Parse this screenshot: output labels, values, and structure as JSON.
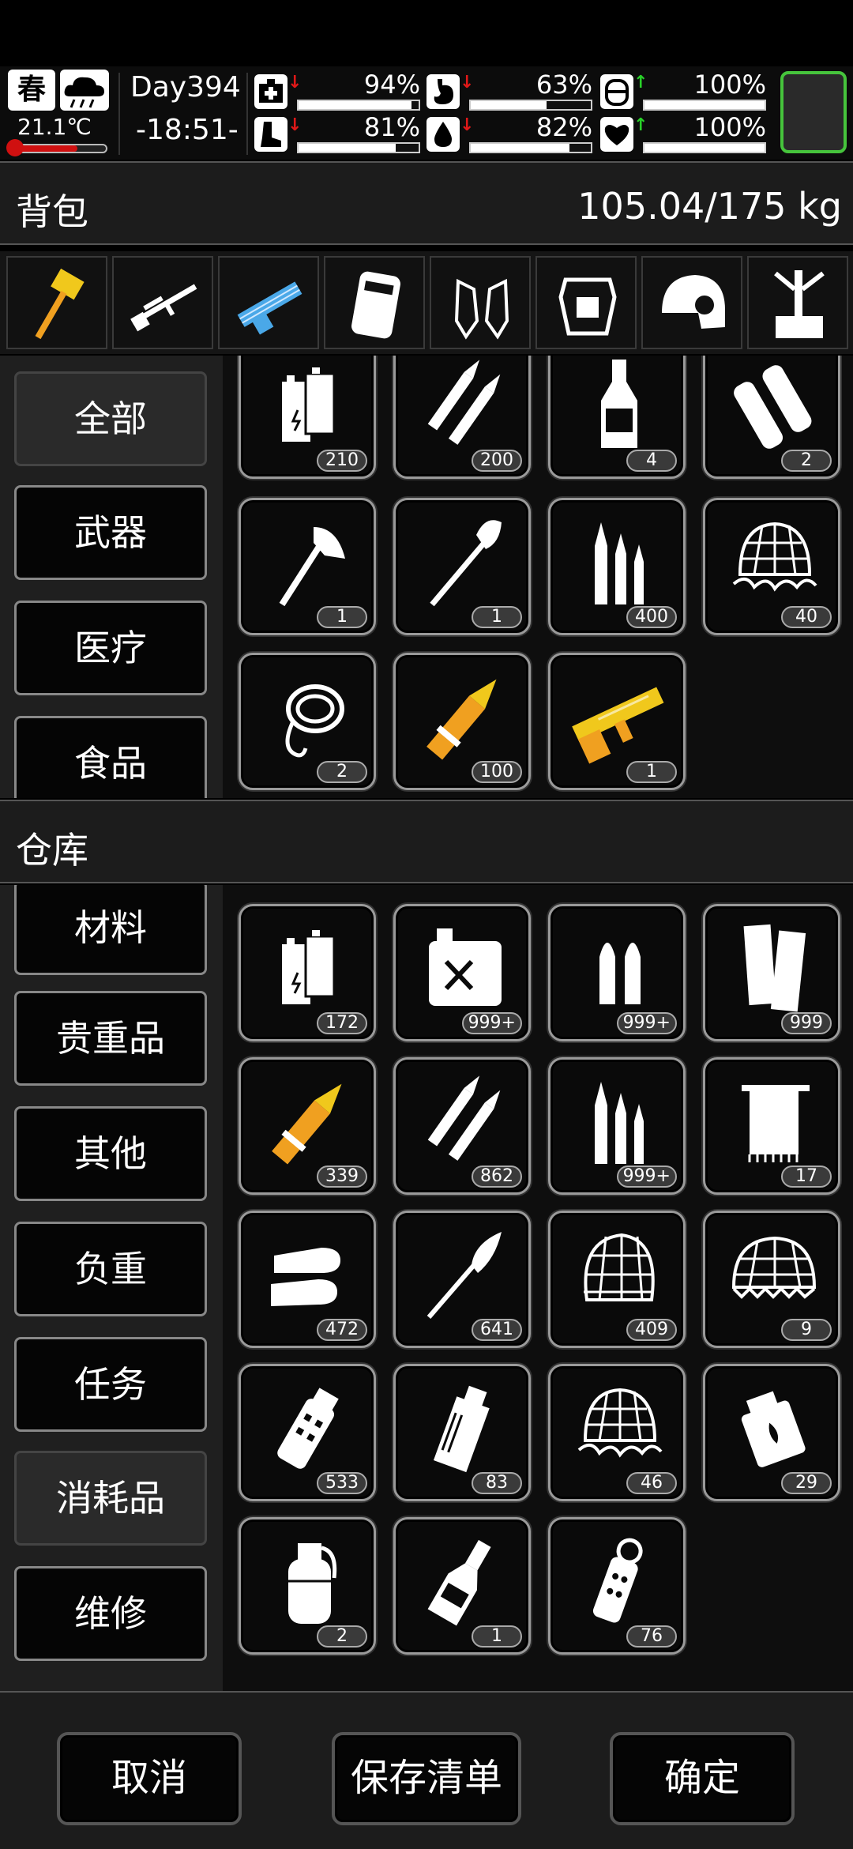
{
  "hud": {
    "season": "春",
    "temperature": "21.1℃",
    "day": "Day394",
    "time": "-18:51-",
    "stats": [
      {
        "name": "health",
        "value": "94%",
        "level": 0.94,
        "arrow": "down",
        "arrow_color": "#e01818"
      },
      {
        "name": "hunger",
        "value": "63%",
        "level": 0.63,
        "arrow": "down",
        "arrow_color": "#e01818"
      },
      {
        "name": "armor",
        "value": "100%",
        "level": 1.0,
        "arrow": "up",
        "arrow_color": "#28d028"
      },
      {
        "name": "stamina",
        "value": "81%",
        "level": 0.81,
        "arrow": "down",
        "arrow_color": "#e01818"
      },
      {
        "name": "thirst",
        "value": "82%",
        "level": 0.82,
        "arrow": "down",
        "arrow_color": "#e01818"
      },
      {
        "name": "mood",
        "value": "100%",
        "level": 1.0,
        "arrow": "up",
        "arrow_color": "#28d028"
      }
    ]
  },
  "backpack": {
    "title": "背包",
    "weight": "105.04/175 kg",
    "equipment": [
      "hammer-icon",
      "sniper-rifle-icon",
      "minigun-icon",
      "vest-icon",
      "gloves-icon",
      "body-armor-icon",
      "helmet-icon",
      "backpack-frame-icon"
    ],
    "categories": [
      "全部",
      "武器",
      "医疗",
      "食品"
    ],
    "items": [
      {
        "icon": "battery-icon",
        "count": "210"
      },
      {
        "icon": "bullets-icon",
        "count": "200"
      },
      {
        "icon": "bottle-icon",
        "count": "4"
      },
      {
        "icon": "cloth-roll-icon",
        "count": "2"
      },
      {
        "icon": "axe-icon",
        "count": "1"
      },
      {
        "icon": "shovel-icon",
        "count": "1"
      },
      {
        "icon": "rifle-ammo-icon",
        "count": "400"
      },
      {
        "icon": "ghillie-net-icon",
        "count": "40"
      },
      {
        "icon": "rope-icon",
        "count": "2"
      },
      {
        "icon": "rocket-icon",
        "count": "100"
      },
      {
        "icon": "shotgun-icon",
        "count": "1"
      }
    ]
  },
  "warehouse": {
    "title": "仓库",
    "categories": [
      "材料",
      "贵重品",
      "其他",
      "负重",
      "任务",
      "消耗品",
      "维修"
    ],
    "active_category": "消耗品",
    "items": [
      {
        "icon": "battery-icon",
        "count": "172"
      },
      {
        "icon": "fuel-can-icon",
        "count": "999+"
      },
      {
        "icon": "pistol-ammo-icon",
        "count": "999+"
      },
      {
        "icon": "shotgun-shells-icon",
        "count": "999"
      },
      {
        "icon": "rocket-icon",
        "count": "339"
      },
      {
        "icon": "bullets-icon",
        "count": "862"
      },
      {
        "icon": "rifle-ammo-icon",
        "count": "999+"
      },
      {
        "icon": "towel-icon",
        "count": "17"
      },
      {
        "icon": "slug-icon",
        "count": "472"
      },
      {
        "icon": "rpg-icon",
        "count": "641"
      },
      {
        "icon": "net-icon",
        "count": "409"
      },
      {
        "icon": "helmet-net-icon",
        "count": "9"
      },
      {
        "icon": "flashbang-icon",
        "count": "533"
      },
      {
        "icon": "smoke-grenade-icon",
        "count": "83"
      },
      {
        "icon": "ghillie-net-icon",
        "count": "46"
      },
      {
        "icon": "incendiary-icon",
        "count": "29"
      },
      {
        "icon": "frag-grenade-icon",
        "count": "2"
      },
      {
        "icon": "molotov-icon",
        "count": "1"
      },
      {
        "icon": "stun-grenade-icon",
        "count": "76"
      }
    ]
  },
  "buttons": {
    "cancel": "取消",
    "save_list": "保存清单",
    "confirm": "确定"
  },
  "colors": {
    "rare": "#f0a020",
    "epic": "#f0c81c",
    "blue": "#4aa8e8",
    "slot_border": "#46c43c"
  }
}
